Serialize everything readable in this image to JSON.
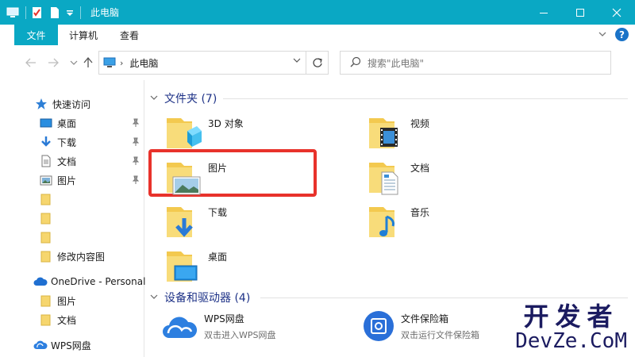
{
  "window": {
    "title": "此电脑",
    "accent": "#0aa8c4"
  },
  "ribbon": {
    "tabs": [
      "文件",
      "计算机",
      "查看"
    ]
  },
  "address": {
    "path": "此电脑",
    "search_placeholder": "搜索\"此电脑\""
  },
  "sidebar": {
    "quick_access": "快速访问",
    "items": [
      {
        "label": "桌面",
        "icon": "desktop-icon",
        "pinned": true
      },
      {
        "label": "下载",
        "icon": "download-icon",
        "pinned": true
      },
      {
        "label": "文档",
        "icon": "document-icon",
        "pinned": true
      },
      {
        "label": "图片",
        "icon": "picture-icon",
        "pinned": true
      },
      {
        "label": "",
        "icon": "folder-icon"
      },
      {
        "label": "",
        "icon": "folder-icon"
      },
      {
        "label": "",
        "icon": "folder-icon"
      },
      {
        "label": "修改内容图",
        "icon": "folder-icon"
      }
    ],
    "onedrive": "OneDrive - Personal",
    "onedrive_items": [
      "图片",
      "文档"
    ],
    "wps": "WPS网盘"
  },
  "folders_group": {
    "title": "文件夹 (7)",
    "items": [
      {
        "label": "3D 对象",
        "icon": "3d-objects-icon"
      },
      {
        "label": "视频",
        "icon": "video-icon"
      },
      {
        "label": "图片",
        "icon": "pictures-icon"
      },
      {
        "label": "文档",
        "icon": "documents-icon"
      },
      {
        "label": "下载",
        "icon": "downloads-icon"
      },
      {
        "label": "音乐",
        "icon": "music-icon"
      },
      {
        "label": "桌面",
        "icon": "desktop-folder-icon"
      }
    ]
  },
  "drives_group": {
    "title": "设备和驱动器 (4)",
    "items": [
      {
        "name": "WPS网盘",
        "sub": "双击进入WPS网盘",
        "icon": "wps-cloud-icon"
      },
      {
        "name": "文件保险箱",
        "sub": "双击运行文件保险箱",
        "icon": "safe-icon"
      }
    ]
  },
  "watermark": {
    "cn": "开发者",
    "en": "DevZe.CoM"
  }
}
